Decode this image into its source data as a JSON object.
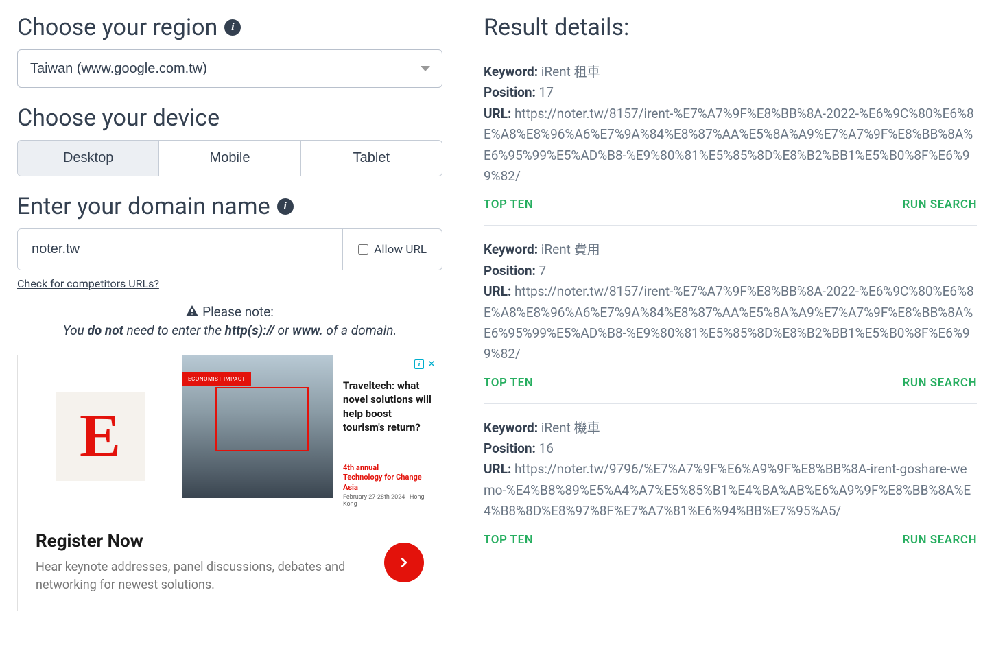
{
  "left": {
    "region": {
      "heading": "Choose your region",
      "value": "Taiwan (www.google.com.tw)"
    },
    "device": {
      "heading": "Choose your device",
      "tabs": [
        "Desktop",
        "Mobile",
        "Tablet"
      ]
    },
    "domain": {
      "heading": "Enter your domain name",
      "value": "noter.tw",
      "allow_url_label": "Allow URL"
    },
    "competitors_link": "Check for competitors URLs?",
    "note": {
      "title": "Please note:",
      "prefix": "You ",
      "bold1": "do not",
      "mid": " need to enter the ",
      "bold2": "http(s)://",
      "mid2": " or ",
      "bold3": "www.",
      "suffix": " of a domain."
    },
    "ad": {
      "badge": "ECONOMIST IMPACT",
      "headline": "Traveltech: what novel solutions will help boost tourism's return?",
      "event_line1": "4th annual",
      "event_line2": "Technology for Change Asia",
      "event_sub": "February 27-28th 2024 | Hong Kong",
      "register": "Register Now",
      "desc": "Hear keynote addresses, panel discussions, debates and networking for newest solutions."
    }
  },
  "right": {
    "heading": "Result details:",
    "labels": {
      "keyword": "Keyword:",
      "position": "Position:",
      "url": "URL:",
      "top_ten": "TOP TEN",
      "run_search": "RUN SEARCH"
    },
    "results": [
      {
        "keyword": "iRent 租車",
        "position": "17",
        "url": "https://noter.tw/8157/irent-%E7%A7%9F%E8%BB%8A-2022-%E6%9C%80%E6%8E%A8%E8%96%A6%E7%9A%84%E8%87%AA%E5%8A%A9%E7%A7%9F%E8%BB%8A%E6%95%99%E5%AD%B8-%E9%80%81%E5%85%8D%E8%B2%BB1%E5%B0%8F%E6%99%82/"
      },
      {
        "keyword": "iRent 費用",
        "position": "7",
        "url": "https://noter.tw/8157/irent-%E7%A7%9F%E8%BB%8A-2022-%E6%9C%80%E6%8E%A8%E8%96%A6%E7%9A%84%E8%87%AA%E5%8A%A9%E7%A7%9F%E8%BB%8A%E6%95%99%E5%AD%B8-%E9%80%81%E5%85%8D%E8%B2%BB1%E5%B0%8F%E6%99%82/"
      },
      {
        "keyword": "iRent 機車",
        "position": "16",
        "url": "https://noter.tw/9796/%E7%A7%9F%E6%A9%9F%E8%BB%8A-irent-goshare-wemo-%E4%B8%89%E5%A4%A7%E5%85%B1%E4%BA%AB%E6%A9%9F%E8%BB%8A%E4%B8%8D%E8%97%8F%E7%A7%81%E6%94%BB%E7%95%A5/"
      }
    ]
  }
}
